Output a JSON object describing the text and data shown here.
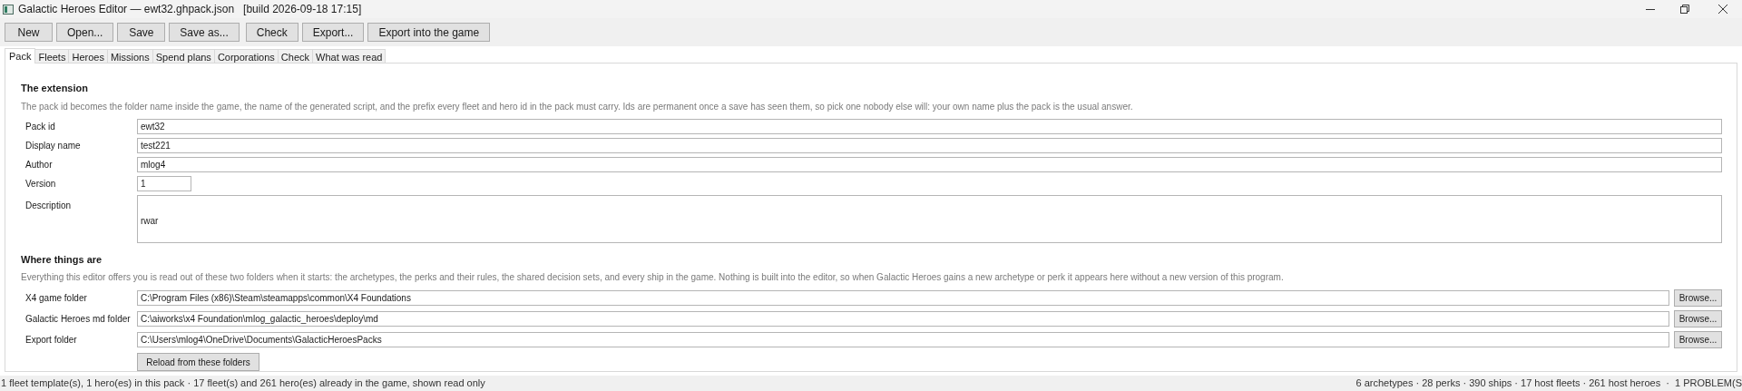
{
  "window": {
    "title": "Galactic Heroes Editor — ewt32.ghpack.json   [build 2026-09-18 17:15]"
  },
  "toolbar": [
    [
      {
        "label": "New"
      },
      {
        "label": "Open..."
      },
      {
        "label": "Save"
      },
      {
        "label": "Save as..."
      }
    ],
    [
      {
        "label": "Check"
      },
      {
        "label": "Export..."
      },
      {
        "label": "Export into the game"
      }
    ]
  ],
  "tabs": [
    {
      "label": "Pack",
      "selected": true
    },
    {
      "label": "Fleets",
      "selected": false
    },
    {
      "label": "Heroes",
      "selected": false
    },
    {
      "label": "Missions",
      "selected": false
    },
    {
      "label": "Spend plans",
      "selected": false
    },
    {
      "label": "Corporations",
      "selected": false
    },
    {
      "label": "Check",
      "selected": false
    },
    {
      "label": "What was read",
      "selected": false
    }
  ],
  "sections": [
    {
      "heading": "The extension",
      "description": "The pack id becomes the folder name inside the game, the name of the generated script, and the prefix every fleet and hero id in the pack must carry. Ids are permanent once a save has seen them, so pick one nobody else will: your own name plus the pack is the usual answer.",
      "fields": [
        {
          "kind": "text",
          "label": "Pack id",
          "value": "ewt32"
        },
        {
          "kind": "text",
          "label": "Display name",
          "value": "test221"
        },
        {
          "kind": "text",
          "label": "Author",
          "value": "mlog4"
        },
        {
          "kind": "short",
          "label": "Version",
          "value": "1"
        },
        {
          "kind": "multiline",
          "label": "Description",
          "value": "rwar"
        }
      ]
    },
    {
      "heading": "Where things are",
      "description": "Everything this editor offers you is read out of these two folders when it starts: the archetypes, the perks and their rules, the shared decision sets, and every ship in the game. Nothing is built into the editor, so when Galactic Heroes gains a new archetype or perk it appears here without a new version of this program.",
      "fields": [
        {
          "kind": "folder",
          "label": "X4 game folder",
          "value": "C:\\Program Files (x86)\\Steam\\steamapps\\common\\X4 Foundations",
          "button": "Browse..."
        },
        {
          "kind": "folder",
          "label": "Galactic Heroes md folder",
          "value": "C:\\aiworks\\x4 Foundation\\mlog_galactic_heroes\\deploy\\md",
          "button": "Browse..."
        },
        {
          "kind": "folder",
          "label": "Export folder",
          "value": "C:\\Users\\mlog4\\OneDrive\\Documents\\GalacticHeroesPacks",
          "button": "Browse..."
        },
        {
          "kind": "button",
          "label": "Reload from these folders"
        }
      ]
    }
  ],
  "status_bar": {
    "left": "1 fleet template(s), 1 hero(es) in this pack · 17 fleet(s) and 261 hero(es) already in the game, shown read only",
    "right": "6 archetypes · 28 perks · 390 ships · 17 host fleets · 261 host heroes  ·  1 PROBLEM(S"
  }
}
